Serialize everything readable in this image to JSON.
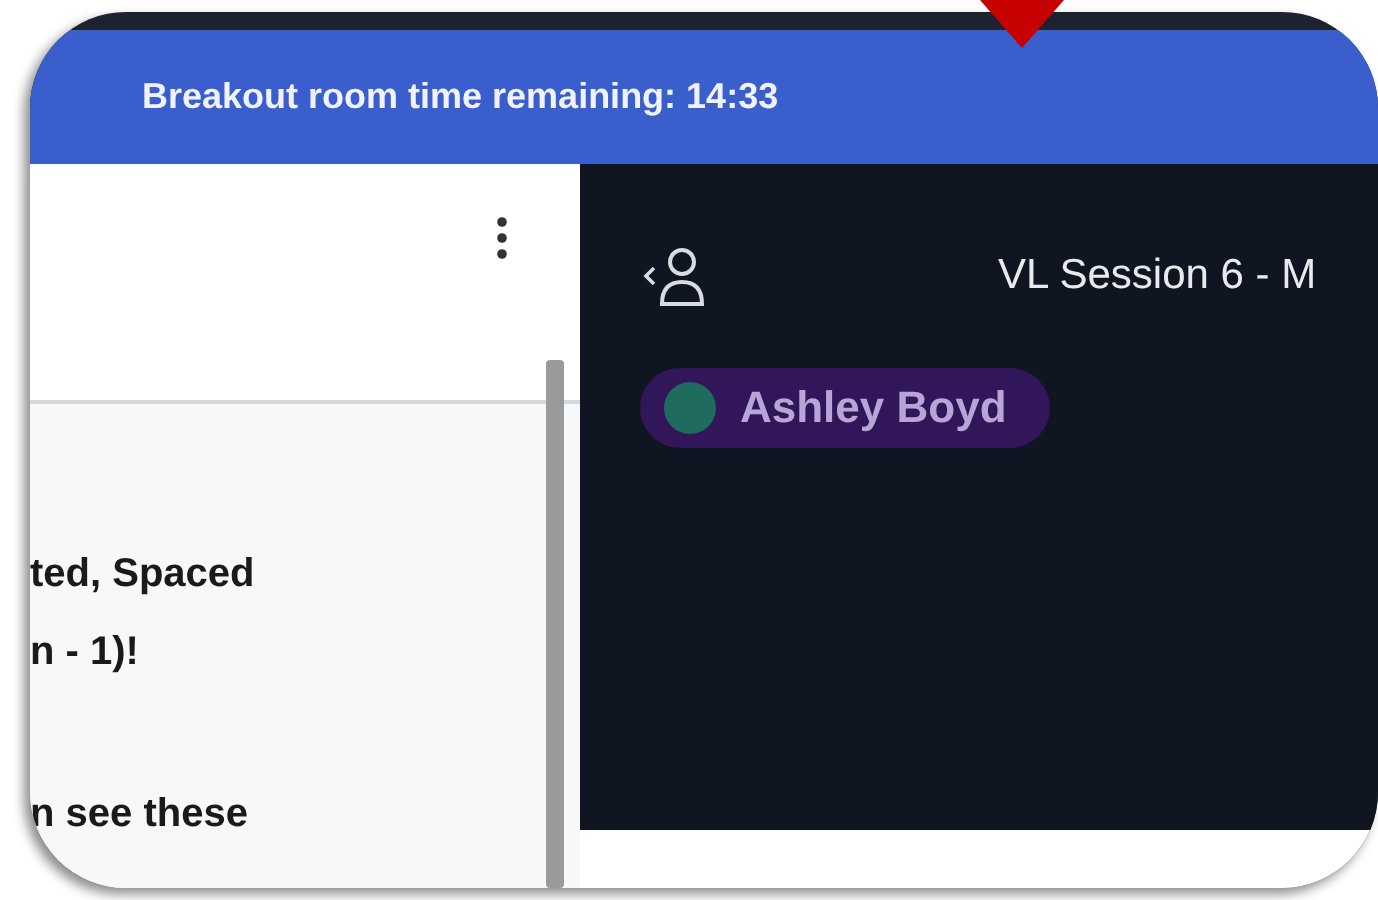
{
  "banner": {
    "text": "Breakout room time remaining: 14:33"
  },
  "left_panel": {
    "lines": [
      "ted, Spaced",
      "n - 1)!",
      "n see these"
    ]
  },
  "right_panel": {
    "title": "VL Session 6 - M",
    "participants": [
      {
        "name": "Ashley Boyd",
        "color": "#1f6b5e"
      }
    ]
  }
}
